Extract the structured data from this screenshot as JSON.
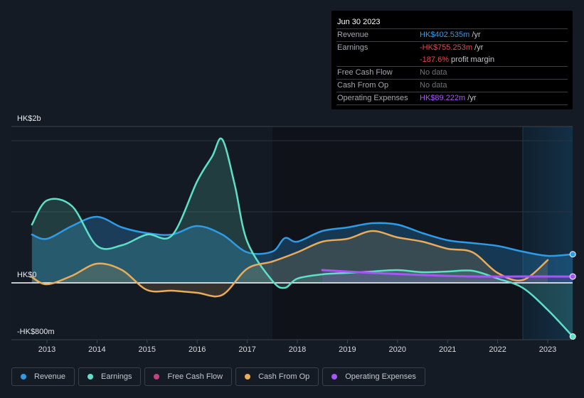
{
  "tooltip": {
    "date": "Jun 30 2023",
    "rows": [
      {
        "label": "Revenue",
        "value": "HK$402.535m",
        "suffix": " /yr",
        "color": "#2f9be6"
      },
      {
        "label": "Earnings",
        "value": "-HK$755.253m",
        "suffix": " /yr",
        "color": "#e5484d"
      },
      {
        "label": "",
        "value": "-187.6%",
        "suffix": " profit margin",
        "color": "#e5484d"
      },
      {
        "label": "Free Cash Flow",
        "value": "No data",
        "suffix": "",
        "color": "#6f747a"
      },
      {
        "label": "Cash From Op",
        "value": "No data",
        "suffix": "",
        "color": "#6f747a"
      },
      {
        "label": "Operating Expenses",
        "value": "HK$89.222m",
        "suffix": " /yr",
        "color": "#a855f7"
      }
    ]
  },
  "legend": [
    {
      "label": "Revenue",
      "color": "#2f9be6"
    },
    {
      "label": "Earnings",
      "color": "#5ee0c8"
    },
    {
      "label": "Free Cash Flow",
      "color": "#c0427e"
    },
    {
      "label": "Cash From Op",
      "color": "#e8ac5b"
    },
    {
      "label": "Operating Expenses",
      "color": "#a855f7"
    }
  ],
  "chart_data": {
    "type": "area",
    "title": "",
    "xlabel": "",
    "ylabel": "",
    "currency": "HK$",
    "units": "millions",
    "y_tick_labels": [
      "HK$2b",
      "HK$0",
      "-HK$800m"
    ],
    "y_ticks": [
      2000,
      0,
      -800
    ],
    "ylim": [
      -800,
      2200
    ],
    "x_tick_labels": [
      "2013",
      "2014",
      "2015",
      "2016",
      "2017",
      "2018",
      "2019",
      "2020",
      "2021",
      "2022",
      "2023"
    ],
    "xlim": [
      2012.7,
      2023.5
    ],
    "grid": true,
    "highlight_region": [
      2022.5,
      2023.5
    ],
    "legend_position": "bottom",
    "series": [
      {
        "name": "Revenue",
        "color": "#2f9be6",
        "x": [
          2012.7,
          2013.0,
          2013.5,
          2014.0,
          2014.5,
          2015.0,
          2015.5,
          2016.0,
          2016.5,
          2017.0,
          2017.5,
          2017.75,
          2018.0,
          2018.5,
          2019.0,
          2019.5,
          2020.0,
          2020.5,
          2021.0,
          2021.5,
          2022.0,
          2022.5,
          2023.0,
          2023.5
        ],
        "values": [
          680,
          620,
          800,
          930,
          780,
          700,
          680,
          800,
          680,
          430,
          440,
          630,
          580,
          730,
          780,
          840,
          820,
          700,
          600,
          560,
          520,
          440,
          380,
          402.5
        ]
      },
      {
        "name": "Earnings",
        "color": "#5ee0c8",
        "x": [
          2012.7,
          2013.0,
          2013.5,
          2014.0,
          2014.5,
          2015.0,
          2015.5,
          2016.0,
          2016.3,
          2016.5,
          2016.75,
          2017.0,
          2017.5,
          2017.75,
          2018.0,
          2018.5,
          2019.0,
          2019.5,
          2020.0,
          2020.5,
          2021.0,
          2021.5,
          2022.0,
          2022.5,
          2023.0,
          2023.5
        ],
        "values": [
          820,
          1160,
          1080,
          520,
          530,
          680,
          670,
          1430,
          1780,
          2020,
          1380,
          580,
          30,
          -70,
          60,
          120,
          140,
          160,
          180,
          150,
          160,
          170,
          60,
          -70,
          -380,
          -755.3
        ]
      },
      {
        "name": "Free Cash Flow",
        "color": "#c0427e",
        "x": [],
        "values": []
      },
      {
        "name": "Cash From Op",
        "color": "#e8ac5b",
        "x": [
          2012.7,
          2013.0,
          2013.5,
          2014.0,
          2014.5,
          2015.0,
          2015.5,
          2016.0,
          2016.5,
          2017.0,
          2017.5,
          2018.0,
          2018.5,
          2019.0,
          2019.5,
          2020.0,
          2020.5,
          2021.0,
          2021.5,
          2022.0,
          2022.5,
          2023.0
        ],
        "values": [
          80,
          -20,
          100,
          270,
          180,
          -100,
          -110,
          -140,
          -170,
          200,
          300,
          430,
          580,
          620,
          730,
          640,
          580,
          480,
          430,
          140,
          40,
          320
        ]
      },
      {
        "name": "Operating Expenses",
        "color": "#a855f7",
        "x": [
          2018.5,
          2019.5,
          2020.5,
          2021.5,
          2022.5,
          2023.5
        ],
        "values": [
          180,
          140,
          110,
          90,
          90,
          89.2
        ]
      }
    ]
  }
}
